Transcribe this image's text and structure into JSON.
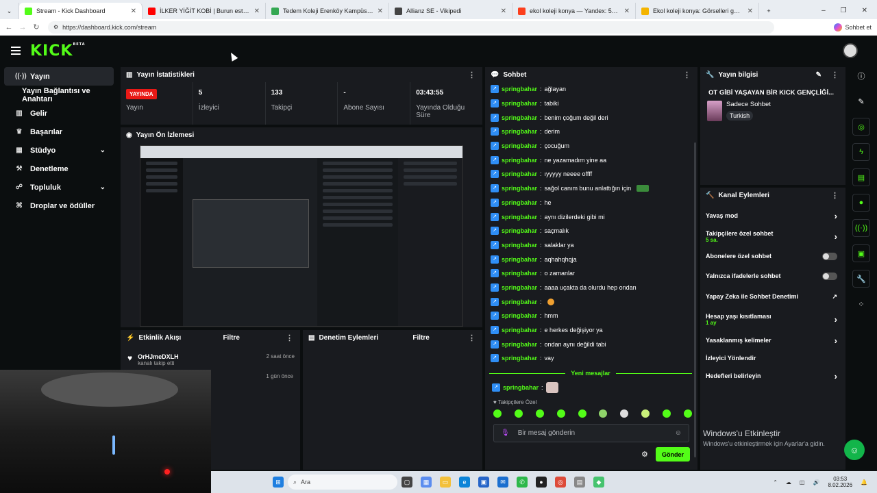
{
  "browser": {
    "tabs": [
      {
        "title": "Stream - Kick Dashboard",
        "color": "#53fc18"
      },
      {
        "title": "İLKER YİĞİT KOBİ | Burun estetiğim",
        "color": "#ff0000"
      },
      {
        "title": "Tedem Koleji Erenköy Kampüsü - G",
        "color": "#34a853"
      },
      {
        "title": "Allianz SE - Vikipedi",
        "color": "#444444"
      },
      {
        "title": "ekol koleji konya — Yandex: 53 bi",
        "color": "#fc3f1d"
      },
      {
        "title": "Ekol koleji konya: Görselleri görün",
        "color": "#f4b400"
      }
    ],
    "url": "https://dashboard.kick.com/stream",
    "chat_ext": "Sohbet et"
  },
  "brand": {
    "logo": "KICK",
    "beta": "BETA"
  },
  "sidebar": {
    "items": [
      {
        "label": "Yayın",
        "icon": "broadcast-icon"
      },
      {
        "label": "Yayın Bağlantısı ve Anahtarı",
        "icon": ""
      },
      {
        "label": "Gelir",
        "icon": "bar-chart-icon"
      },
      {
        "label": "Başarılar",
        "icon": "trophy-icon"
      },
      {
        "label": "Stüdyo",
        "icon": "studio-icon"
      },
      {
        "label": "Denetleme",
        "icon": "hammer-icon"
      },
      {
        "label": "Topluluk",
        "icon": "community-icon"
      },
      {
        "label": "Droplar ve ödüller",
        "icon": "gift-icon"
      }
    ]
  },
  "stats_panel": {
    "title": "Yayın İstatistikleri",
    "live_badge": "YAYINDA",
    "items": [
      {
        "value": "",
        "label": "Yayın"
      },
      {
        "value": "5",
        "label": "İzleyici"
      },
      {
        "value": "133",
        "label": "Takipçi"
      },
      {
        "value": "-",
        "label": "Abone Sayısı"
      },
      {
        "value": "03:43:55",
        "label": "Yayında Olduğu Süre"
      }
    ]
  },
  "preview_panel": {
    "title": "Yayın Ön İzlemesi"
  },
  "activity_panel": {
    "title": "Etkinlik Akışı",
    "filter": "Filtre",
    "items": [
      {
        "user": "OrHJmeDXLH",
        "text": "kanalı takip etti",
        "time": "2 saat önce"
      },
      {
        "user": "",
        "text": "",
        "time": "1 gün önce"
      }
    ]
  },
  "moderation_panel": {
    "title": "Denetim Eylemleri",
    "filter": "Filtre"
  },
  "chat": {
    "title": "Sohbet",
    "messages": [
      {
        "user": "springbahar",
        "text": "ağlayan"
      },
      {
        "user": "springbahar",
        "text": "tabiki"
      },
      {
        "user": "springbahar",
        "text": "benim çoğum değil deri"
      },
      {
        "user": "springbahar",
        "text": "derim"
      },
      {
        "user": "springbahar",
        "text": "çocuğum"
      },
      {
        "user": "springbahar",
        "text": "ne yazamadım yine aa"
      },
      {
        "user": "springbahar",
        "text": "ıyyyyy neeee offff"
      },
      {
        "user": "springbahar",
        "text": "sağol canım bunu anlattığın için"
      },
      {
        "user": "springbahar",
        "text": "he"
      },
      {
        "user": "springbahar",
        "text": "aynı dizilerdeki gibi mi"
      },
      {
        "user": "springbahar",
        "text": "saçmalık"
      },
      {
        "user": "springbahar",
        "text": "salaklar ya"
      },
      {
        "user": "springbahar",
        "text": "aqhahqhqja"
      },
      {
        "user": "springbahar",
        "text": "o zamanlar"
      },
      {
        "user": "springbahar",
        "text": "aaaa uçakta da olurdu hep ondan"
      },
      {
        "user": "springbahar",
        "text": ""
      },
      {
        "user": "springbahar",
        "text": "hmm"
      },
      {
        "user": "springbahar",
        "text": "e herkes değişiyor ya"
      },
      {
        "user": "springbahar",
        "text": "ondan aynı değildi tabi"
      },
      {
        "user": "springbahar",
        "text": "vay"
      }
    ],
    "new_messages": "Yeni mesajlar",
    "last_message": {
      "user": "springbahar",
      "text": ""
    },
    "followers_only": "Takipçilere Özel",
    "input_placeholder": "Bir mesaj gönderin",
    "send": "Gönder"
  },
  "stream_info": {
    "title": "Yayın bilgisi",
    "stream_title": "OT GİBİ YAŞAYAN BİR KICK GENÇLİĞİ...",
    "category": "Sadece Sohbet",
    "language": "Turkish"
  },
  "channel_actions": {
    "title": "Kanal Eylemleri",
    "items": [
      {
        "label": "Yavaş mod",
        "sub": "",
        "control": "chevron"
      },
      {
        "label": "Takipçilere özel sohbet",
        "sub": "5 sa.",
        "control": "chevron"
      },
      {
        "label": "Abonelere özel sohbet",
        "sub": "",
        "control": "toggle"
      },
      {
        "label": "Yalnızca ifadelerle sohbet",
        "sub": "",
        "control": "toggle"
      },
      {
        "label": "Yapay Zeka ile Sohbet Denetimi",
        "sub": "",
        "control": "external"
      },
      {
        "label": "Hesap yaşı kısıtlaması",
        "sub": "1 ay",
        "control": "chevron"
      },
      {
        "label": "Yasaklanmış kelimeler",
        "sub": "",
        "control": "chevron"
      },
      {
        "label": "İzleyici Yönlendir",
        "sub": "",
        "control": ""
      },
      {
        "label": "Hedefleri belirleyin",
        "sub": "",
        "control": "chevron"
      }
    ]
  },
  "windows": {
    "watermark_title": "Windows'u Etkinleştir",
    "watermark_text": "Windows'u etkinleştirmek için Ayarlar'a gidin.",
    "search": "Ara",
    "time": "03:53",
    "date": "8.02.2026"
  }
}
